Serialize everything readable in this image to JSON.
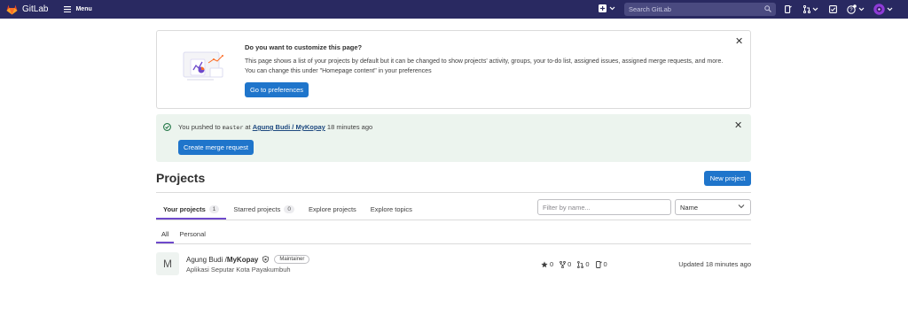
{
  "nav": {
    "brand": "GitLab",
    "menu_label": "Menu",
    "search_placeholder": "Search GitLab",
    "colors": {
      "bar": "#292961",
      "accent": "#6e49cb",
      "primary": "#1f75cb"
    }
  },
  "customize_banner": {
    "title": "Do you want to customize this page?",
    "body": "This page shows a list of your projects by default but it can be changed to show projects' activity, groups, your to-do list, assigned issues, assigned merge requests, and more. You can change this under \"Homepage content\" in your preferences",
    "button": "Go to preferences"
  },
  "push_banner": {
    "prefix": "You pushed to",
    "branch": "master",
    "at": "at",
    "project_link": "Agung Budi / MyKopay",
    "time": "18 minutes ago",
    "button": "Create merge request"
  },
  "page": {
    "title": "Projects",
    "new_project": "New project"
  },
  "tabs": [
    {
      "label": "Your projects",
      "count": "1"
    },
    {
      "label": "Starred projects",
      "count": "0"
    },
    {
      "label": "Explore projects"
    },
    {
      "label": "Explore topics"
    }
  ],
  "filter": {
    "placeholder": "Filter by name..."
  },
  "sort": {
    "selected": "Name"
  },
  "subtabs": [
    "All",
    "Personal"
  ],
  "project": {
    "avatar_letter": "M",
    "namespace": "Agung Budi / ",
    "name": "MyKopay",
    "role": "Maintainer",
    "description": "Aplikasi Seputar Kota Payakumbuh",
    "stars": "0",
    "forks": "0",
    "merge_requests": "0",
    "issues": "0",
    "updated": "Updated 18 minutes ago"
  }
}
